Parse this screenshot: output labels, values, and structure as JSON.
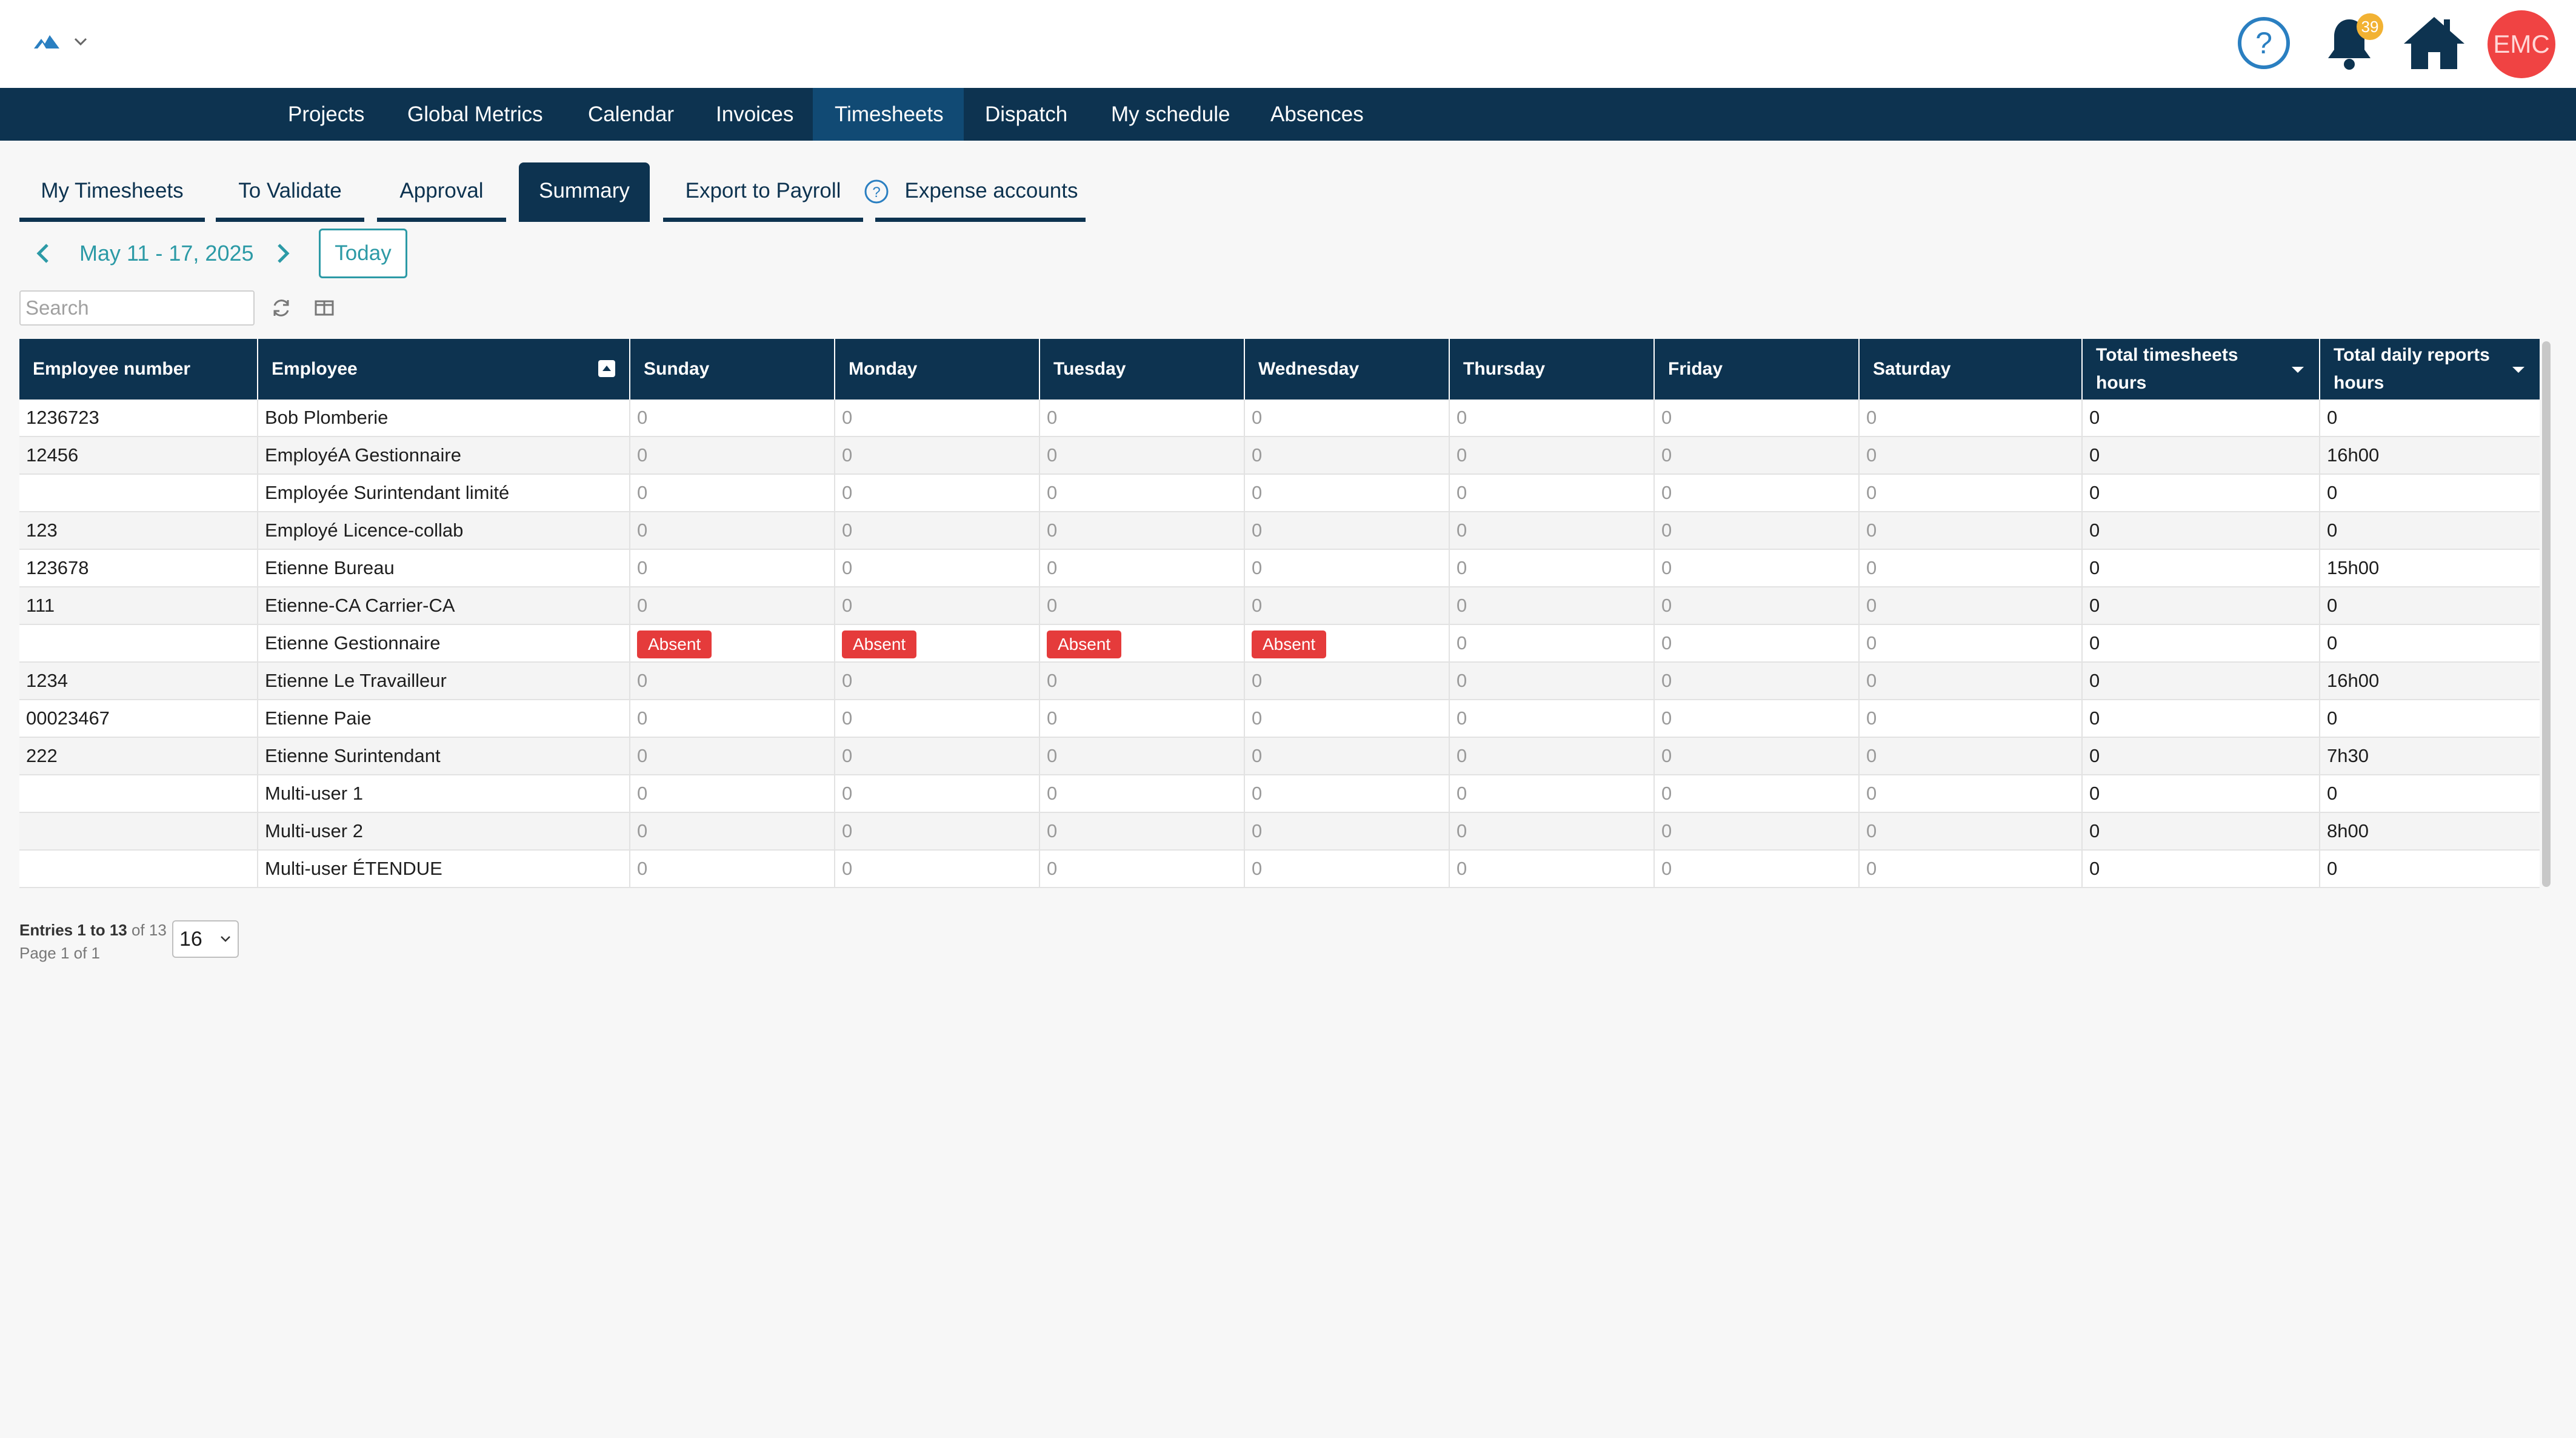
{
  "header": {
    "notification_count": "39",
    "avatar_initials": "EMC"
  },
  "main_nav": [
    {
      "label": "Projects"
    },
    {
      "label": "Global Metrics"
    },
    {
      "label": "Calendar"
    },
    {
      "label": "Invoices"
    },
    {
      "label": "Timesheets",
      "active": true
    },
    {
      "label": "Dispatch"
    },
    {
      "label": "My schedule"
    },
    {
      "label": "Absences"
    }
  ],
  "sub_tabs": [
    {
      "label": "My Timesheets"
    },
    {
      "label": "To Validate"
    },
    {
      "label": "Approval"
    },
    {
      "label": "Summary",
      "active": true
    },
    {
      "label": "Export to Payroll"
    },
    {
      "label": "Expense accounts"
    }
  ],
  "date_nav": {
    "range": "May 11 - 17, 2025",
    "today_label": "Today"
  },
  "search": {
    "placeholder": "Search",
    "value": ""
  },
  "table": {
    "headers": [
      "Employee number",
      "Employee",
      "Sunday",
      "Monday",
      "Tuesday",
      "Wednesday",
      "Thursday",
      "Friday",
      "Saturday",
      "Total timesheets hours",
      "Total daily reports hours"
    ],
    "rows": [
      [
        "1236723",
        "Bob Plomberie",
        "0",
        "0",
        "0",
        "0",
        "0",
        "0",
        "0",
        "0",
        "0"
      ],
      [
        "12456",
        "EmployéA Gestionnaire",
        "0",
        "0",
        "0",
        "0",
        "0",
        "0",
        "0",
        "0",
        "16h00"
      ],
      [
        "",
        "Employée Surintendant limité",
        "0",
        "0",
        "0",
        "0",
        "0",
        "0",
        "0",
        "0",
        "0"
      ],
      [
        "123",
        "Employé Licence-collab",
        "0",
        "0",
        "0",
        "0",
        "0",
        "0",
        "0",
        "0",
        "0"
      ],
      [
        "123678",
        "Etienne Bureau",
        "0",
        "0",
        "0",
        "0",
        "0",
        "0",
        "0",
        "0",
        "15h00"
      ],
      [
        "111",
        "Etienne-CA Carrier-CA",
        "0",
        "0",
        "0",
        "0",
        "0",
        "0",
        "0",
        "0",
        "0"
      ],
      [
        "",
        "Etienne Gestionnaire",
        "Absent",
        "Absent",
        "Absent",
        "Absent",
        "0",
        "0",
        "0",
        "0",
        "0"
      ],
      [
        "1234",
        "Etienne Le Travailleur",
        "0",
        "0",
        "0",
        "0",
        "0",
        "0",
        "0",
        "0",
        "16h00"
      ],
      [
        "00023467",
        "Etienne Paie",
        "0",
        "0",
        "0",
        "0",
        "0",
        "0",
        "0",
        "0",
        "0"
      ],
      [
        "222",
        "Etienne Surintendant",
        "0",
        "0",
        "0",
        "0",
        "0",
        "0",
        "0",
        "0",
        "7h30"
      ],
      [
        "",
        "Multi-user 1",
        "0",
        "0",
        "0",
        "0",
        "0",
        "0",
        "0",
        "0",
        "0"
      ],
      [
        "",
        "Multi-user 2",
        "0",
        "0",
        "0",
        "0",
        "0",
        "0",
        "0",
        "0",
        "8h00"
      ],
      [
        "",
        "Multi-user ÉTENDUE",
        "0",
        "0",
        "0",
        "0",
        "0",
        "0",
        "0",
        "0",
        "0"
      ]
    ]
  },
  "pagination": {
    "entries_label": "Entries 1 to 13",
    "of_label": "of 13",
    "page_label": "Page 1 of 1",
    "page_size": "16"
  },
  "colors": {
    "nav_bg": "#0d3350",
    "nav_active": "#114a74",
    "accent": "#2c9aa6",
    "absent": "#e53b3b",
    "avatar": "#f04343",
    "badge": "#f2b233"
  }
}
